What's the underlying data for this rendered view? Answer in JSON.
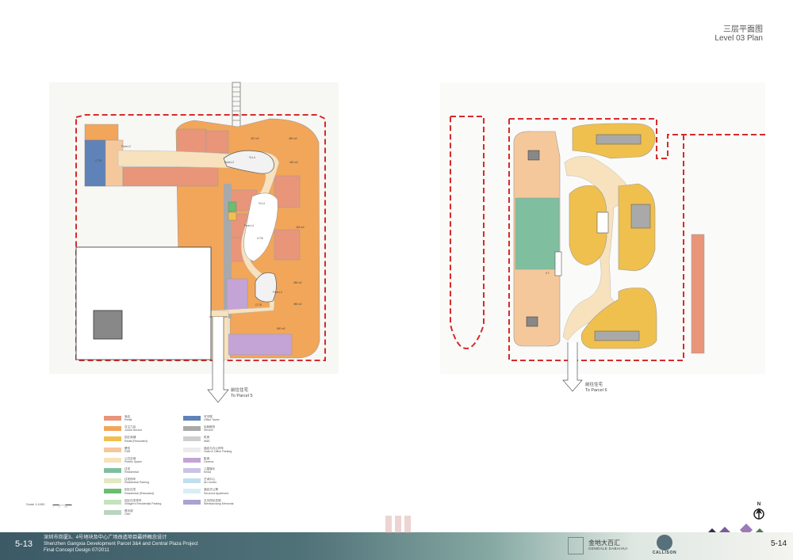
{
  "title": {
    "zh": "三层平面图",
    "en": "Level 03 Plan"
  },
  "left_plan": {
    "labels": {
      "from_l2_a": "From L2",
      "from_l2_b": "From L2",
      "to_l4_a": "To L4",
      "to_l4_b": "To L4",
      "from_l4": "From L4",
      "from_l2_c": "From L2",
      "open_a": "O.T.B",
      "open_b": "O.T.B",
      "void_label": "X.T.B"
    },
    "areas": [
      "310 m2",
      "480 m2",
      "440 m2",
      "418 m2",
      "380 m2",
      "480 m2",
      "800 m2"
    ],
    "to_parcel": {
      "zh": "前往住宅",
      "en": "To Parcel 5"
    }
  },
  "right_plan": {
    "void_label": "X.T",
    "to_parcel": {
      "zh": "前往住宅",
      "en": "To Parcel 6"
    }
  },
  "legend": {
    "col1": [
      {
        "zh": "商店",
        "en": "Retail",
        "color": "#e8957a"
      },
      {
        "zh": "次主力店",
        "en": "Junior Anchor",
        "color": "#f2a65a"
      },
      {
        "zh": "回迁商铺",
        "en": "Retail (Relocated)",
        "color": "#f0c04e"
      },
      {
        "zh": "餐饮",
        "en": "F&B",
        "color": "#f5c89c"
      },
      {
        "zh": "公共空间",
        "en": "Pubilic Space",
        "color": "#f7e2bd"
      },
      {
        "zh": "住宅",
        "en": "Residential",
        "color": "#7fbf9f"
      },
      {
        "zh": "住宅停车",
        "en": "Residential Parking",
        "color": "#e2e8c0"
      },
      {
        "zh": "回迁住宅",
        "en": "Residential (Relocated)",
        "color": "#6bbd70"
      },
      {
        "zh": "回迁住宅停车",
        "en": "Villager's Residential Parking",
        "color": "#c4e3bd"
      },
      {
        "zh": "俱乐部",
        "en": "Club",
        "color": "#b9d4c0"
      }
    ],
    "col2": [
      {
        "zh": "写字楼",
        "en": "Office Tower",
        "color": "#5f82b8"
      },
      {
        "zh": "后勤服务",
        "en": "Service",
        "color": "#a9a9a9"
      },
      {
        "zh": "机房",
        "en": "M&E",
        "color": "#cfcfcf"
      },
      {
        "zh": "酒店与办公停车",
        "en": "Hotel & Office Parking",
        "color": "#ebebeb"
      },
      {
        "zh": "影城",
        "en": "Cinema",
        "color": "#c4a3d6"
      },
      {
        "zh": "儿童娱乐",
        "en": "Kinda",
        "color": "#c9c4e6"
      },
      {
        "zh": "艺术中心",
        "en": "Art Center",
        "color": "#bfe0ef"
      },
      {
        "zh": "酒店式公寓",
        "en": "Serviced Apartment",
        "color": "#d9eef5"
      },
      {
        "zh": "文天祥纪念馆",
        "en": "Wentianxiang Memorial",
        "color": "#a9a3cf"
      }
    ]
  },
  "scale": {
    "label": "Scale 1:1000",
    "ticks": [
      "0",
      "10",
      "20m"
    ]
  },
  "north": "N",
  "footer": {
    "page_left": "5-13",
    "line1": "深圳市岗厦3、4号地块及中心广场改造项目最终概念设计",
    "line2": "Shenzhen Gangxia  Development Parcel 3&4 and Central Plaza Project",
    "line3": "Final Concept Design  07/2011",
    "page_right": "5-14",
    "logo_gemdale": {
      "zh": "金地大百汇",
      "en": "GEMDALE DABAIHUI"
    },
    "logo_callison": "CALLISON"
  },
  "colors": {
    "retail": "#e8957a",
    "anchor": "#f2a65a",
    "relocated": "#f0c04e",
    "fb": "#f5c89c",
    "public": "#f7e2bd",
    "office": "#5f82b8",
    "cinema": "#c4a3d6",
    "residential": "#7fbf9f",
    "boundary": "#d62b2b"
  }
}
